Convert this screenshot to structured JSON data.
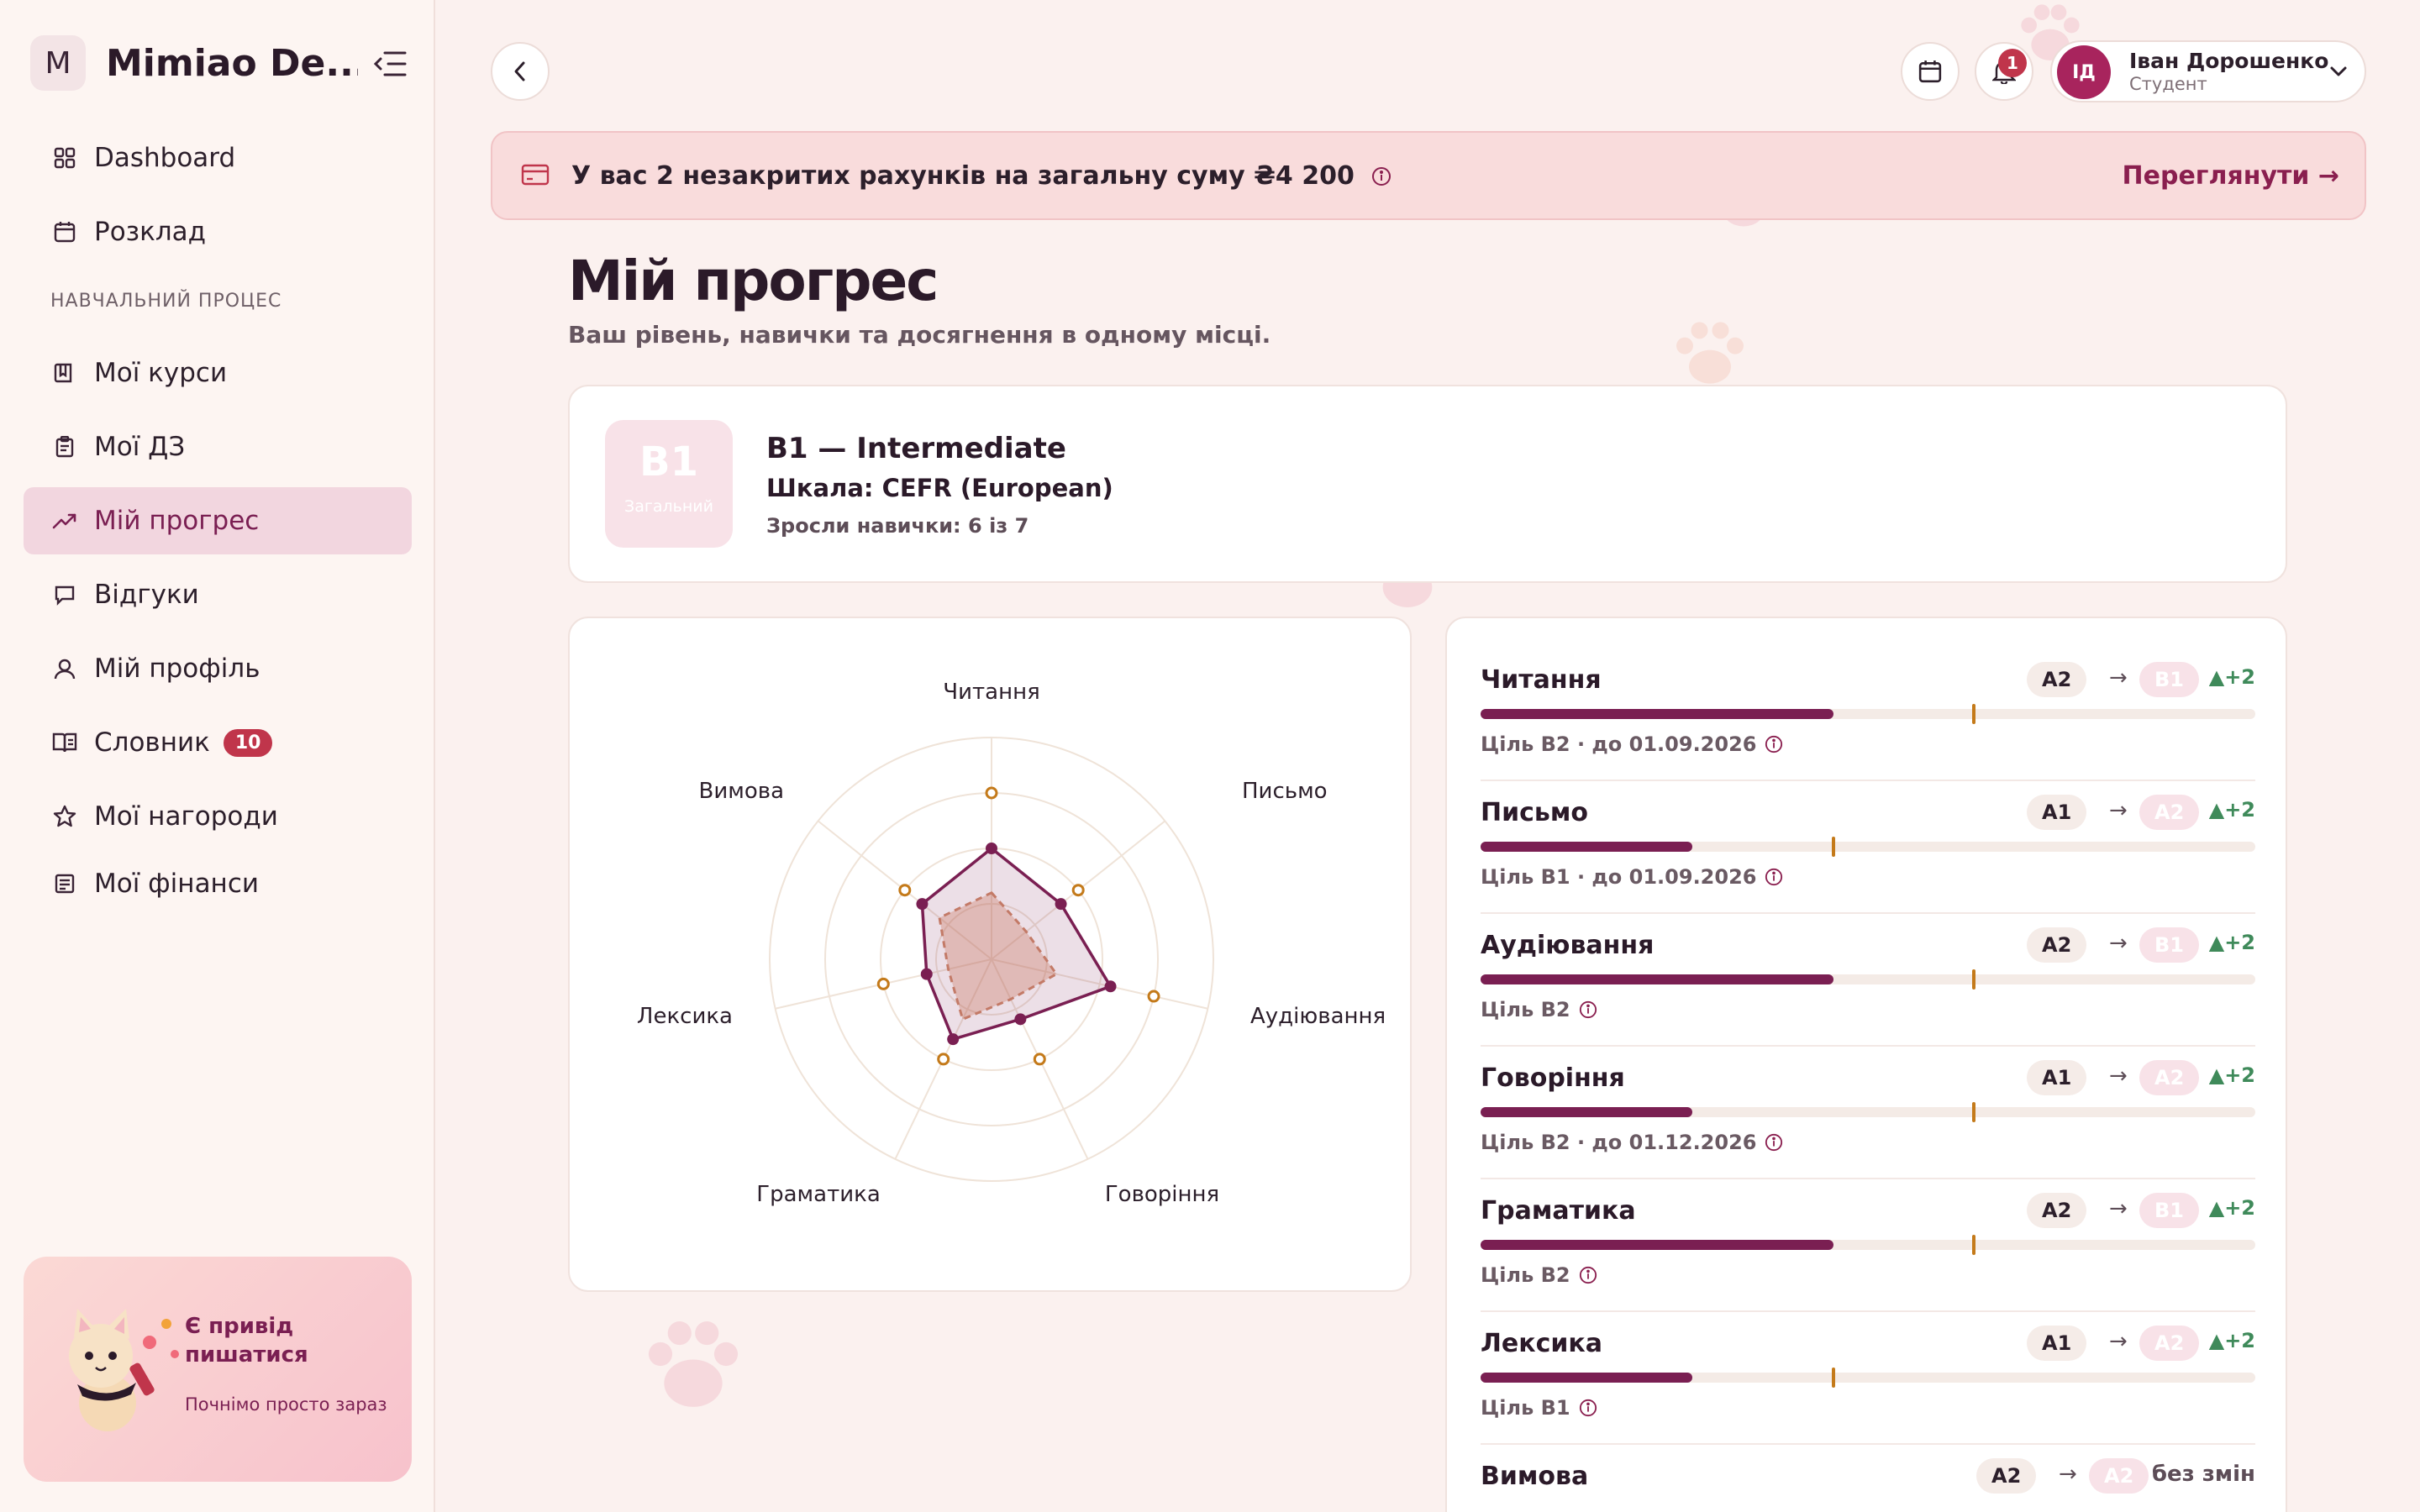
{
  "app": {
    "logo_letter": "M",
    "name": "Mimiao De..."
  },
  "sidebar": {
    "items_top": [
      {
        "label": "Dashboard",
        "icon": "grid-icon"
      },
      {
        "label": "Розклад",
        "icon": "calendar-icon"
      }
    ],
    "section_label": "НАВЧАЛЬНИЙ ПРОЦЕС",
    "items_main": [
      {
        "label": "Мої курси",
        "icon": "book-icon"
      },
      {
        "label": "Мої ДЗ",
        "icon": "clipboard-icon"
      },
      {
        "label": "Мій прогрес",
        "icon": "trending-up-icon",
        "active": true
      },
      {
        "label": "Відгуки",
        "icon": "message-icon"
      },
      {
        "label": "Мій профіль",
        "icon": "user-icon"
      },
      {
        "label": "Словник",
        "icon": "dictionary-icon",
        "badge": "10"
      },
      {
        "label": "Мої нагороди",
        "icon": "star-icon"
      },
      {
        "label": "Мої фінанси",
        "icon": "receipt-icon"
      }
    ],
    "promo": {
      "title": "Є привід пишатися",
      "subtitle": "Почнімо просто зараз"
    }
  },
  "header": {
    "notifications_count": "1",
    "user": {
      "initials": "ІД",
      "name": "Іван Дорошенко",
      "role": "Студент"
    }
  },
  "banner": {
    "text": "У вас 2 незакритих рахунків на загальну суму ₴4 200",
    "link": "Переглянути →"
  },
  "page": {
    "title": "Мій прогрес",
    "subtitle": "Ваш рівень, навички та досягнення в одному місці."
  },
  "level": {
    "badge": "B1",
    "badge_sub": "Загальний",
    "title": "B1 — Intermediate",
    "scale": "Шкала: CEFR (European)",
    "grown": "Зросли навички: 6 із 7"
  },
  "colors": {
    "accent": "#7a1f52",
    "target": "#c47a1a",
    "growth": "#3f8a5a",
    "alert": "#c0354b"
  },
  "chart_data": {
    "type": "radar",
    "axes": [
      "Читання",
      "Письмо",
      "Аудіювання",
      "Говоріння",
      "Граматика",
      "Лексика",
      "Вимова"
    ],
    "rings": 4,
    "series": [
      {
        "values": [
          0.5,
          0.4,
          0.55,
          0.3,
          0.4,
          0.3,
          0.4
        ]
      },
      {
        "values": [
          0.3,
          0.2,
          0.3,
          0.2,
          0.3,
          0.2,
          0.3
        ]
      },
      {
        "values": [
          0.75,
          0.5,
          0.75,
          0.5,
          0.5,
          0.5,
          0.5
        ]
      }
    ]
  },
  "skills": [
    {
      "name": "Читання",
      "from": "A2",
      "to": "B1",
      "delta": "▲+2",
      "progress": 0.455,
      "target": 0.635,
      "goal": "Ціль B2 · до 01.09.2026"
    },
    {
      "name": "Письмо",
      "from": "A1",
      "to": "A2",
      "delta": "▲+2",
      "progress": 0.273,
      "target": 0.453,
      "goal": "Ціль B1 · до 01.09.2026"
    },
    {
      "name": "Аудіювання",
      "from": "A2",
      "to": "B1",
      "delta": "▲+2",
      "progress": 0.455,
      "target": 0.635,
      "goal": "Ціль B2"
    },
    {
      "name": "Говоріння",
      "from": "A1",
      "to": "A2",
      "delta": "▲+2",
      "progress": 0.273,
      "target": 0.635,
      "goal": "Ціль B2 · до 01.12.2026"
    },
    {
      "name": "Граматика",
      "from": "A2",
      "to": "B1",
      "delta": "▲+2",
      "progress": 0.455,
      "target": 0.635,
      "goal": "Ціль B2"
    },
    {
      "name": "Лексика",
      "from": "A1",
      "to": "A2",
      "delta": "▲+2",
      "progress": 0.273,
      "target": 0.453,
      "goal": "Ціль B1"
    },
    {
      "name": "Вимова",
      "from": "A2",
      "to": "A2",
      "delta": "без змін"
    }
  ]
}
